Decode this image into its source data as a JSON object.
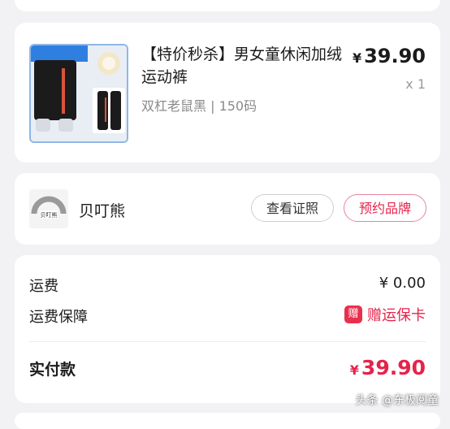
{
  "product": {
    "title": "【特价秒杀】男女童休闲加绒运动裤",
    "variant": "双杠老鼠黑 | 150码",
    "price_symbol": "¥",
    "price": "39.90",
    "quantity": "x 1"
  },
  "shop": {
    "name": "贝叮熊",
    "logo_text": "贝叮熊",
    "cert_button": "查看证照",
    "brand_button": "预约品牌"
  },
  "costs": {
    "shipping_label": "运费",
    "shipping_value": "¥ 0.00",
    "guarantee_label": "运费保障",
    "guarantee_badge": "赠",
    "guarantee_value": "赠运保卡",
    "total_label": "实付款",
    "total_symbol": "¥",
    "total_value": "39.90"
  },
  "watermark": "头条 @东极阅童",
  "colors": {
    "accent": "#e5234a",
    "background": "#f2f2f4"
  }
}
